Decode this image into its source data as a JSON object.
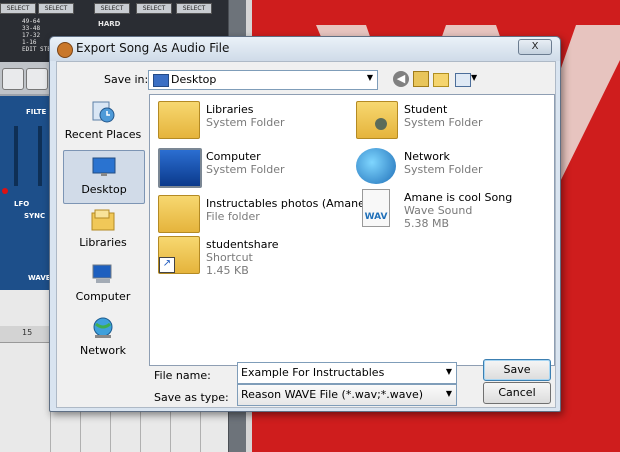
{
  "background": {
    "rack": {
      "select_labels": [
        "SELECT",
        "SELECT",
        "SELECT",
        "SELECT",
        "SELECT",
        "SELECT"
      ],
      "step_ranges": [
        "49-64",
        "33-48",
        "17-32",
        "1-16"
      ],
      "edit_steps": "EDIT STEPS",
      "hard_label": "HARD",
      "filter_label": "FILTE",
      "lfo_label": "LFO",
      "sync_label": "SYNC",
      "wave_label": "WAVE",
      "seq_bar_number": "15"
    }
  },
  "dialog": {
    "title": "Export Song As Audio File",
    "close_label": "X",
    "save_in_label": "Save in:",
    "save_in_value": "Desktop",
    "toolbar": {
      "back_icon": "back-arrow-icon",
      "up_icon": "up-folder-icon",
      "new_folder_icon": "new-folder-icon",
      "view_icon": "view-menu-icon"
    },
    "places": [
      {
        "label": "Recent Places",
        "icon": "recent-places-icon",
        "selected": false
      },
      {
        "label": "Desktop",
        "icon": "desktop-icon",
        "selected": true
      },
      {
        "label": "Libraries",
        "icon": "libraries-icon",
        "selected": false
      },
      {
        "label": "Computer",
        "icon": "computer-icon",
        "selected": false
      },
      {
        "label": "Network",
        "icon": "network-icon",
        "selected": false
      }
    ],
    "files": [
      {
        "name": "Libraries",
        "type": "System Folder",
        "size": "",
        "icon": "libraries-folder-icon"
      },
      {
        "name": "Student",
        "type": "System Folder",
        "size": "",
        "icon": "user-folder-icon"
      },
      {
        "name": "Computer",
        "type": "System Folder",
        "size": "",
        "icon": "computer-icon"
      },
      {
        "name": "Network",
        "type": "System Folder",
        "size": "",
        "icon": "network-globe-icon"
      },
      {
        "name": "Instructables photos (Amane)",
        "type": "File folder",
        "size": "",
        "icon": "folder-icon"
      },
      {
        "name": "Amane is cool Song",
        "type": "Wave Sound",
        "size": "5.38 MB",
        "icon": "wav-file-icon"
      },
      {
        "name": "studentshare",
        "type": "Shortcut",
        "size": "1.45 KB",
        "icon": "shortcut-folder-icon"
      }
    ],
    "file_name_label": "File name:",
    "file_name_value": "Example For Instructables",
    "save_as_type_label": "Save as type:",
    "save_as_type_value": "Reason WAVE File (*.wav;*.wave)",
    "save_button": "Save",
    "cancel_button": "Cancel",
    "wav_icon_text": "WAV",
    "dropdown_arrow": "▼"
  }
}
